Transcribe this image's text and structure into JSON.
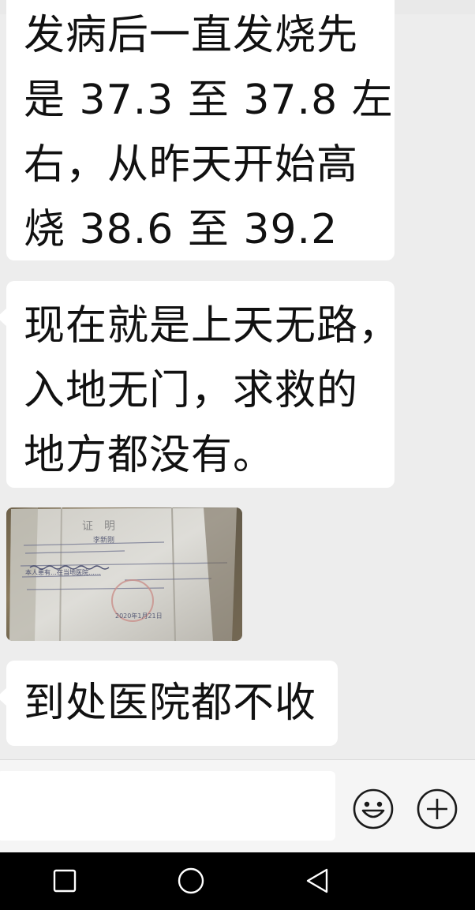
{
  "messages": [
    {
      "lines": [
        "发病后一直发烧先",
        "是 37.3 至 37.8 左",
        "右，从昨天开始高",
        "烧 38.6 至 39.2"
      ]
    },
    {
      "lines": [
        "现在就是上天无路，",
        "入地无门，求救的",
        "地方都没有。"
      ]
    },
    {
      "type": "image",
      "image_lettering": [
        "证　明",
        "李新刚",
        "本人患有…在当地医院……",
        "2020年1月21日"
      ]
    },
    {
      "lines": [
        "到处医院都不收"
      ]
    }
  ],
  "input": {
    "value": "",
    "placeholder": ""
  },
  "icons": {
    "emoji": "smiley-face-icon",
    "plus": "plus-circle-icon",
    "nav_recent": "square-icon",
    "nav_home": "circle-icon",
    "nav_back": "triangle-back-icon"
  },
  "colors": {
    "background": "#ededed",
    "bubble": "#ffffff",
    "text": "#111111",
    "nav_bar": "#000000"
  }
}
